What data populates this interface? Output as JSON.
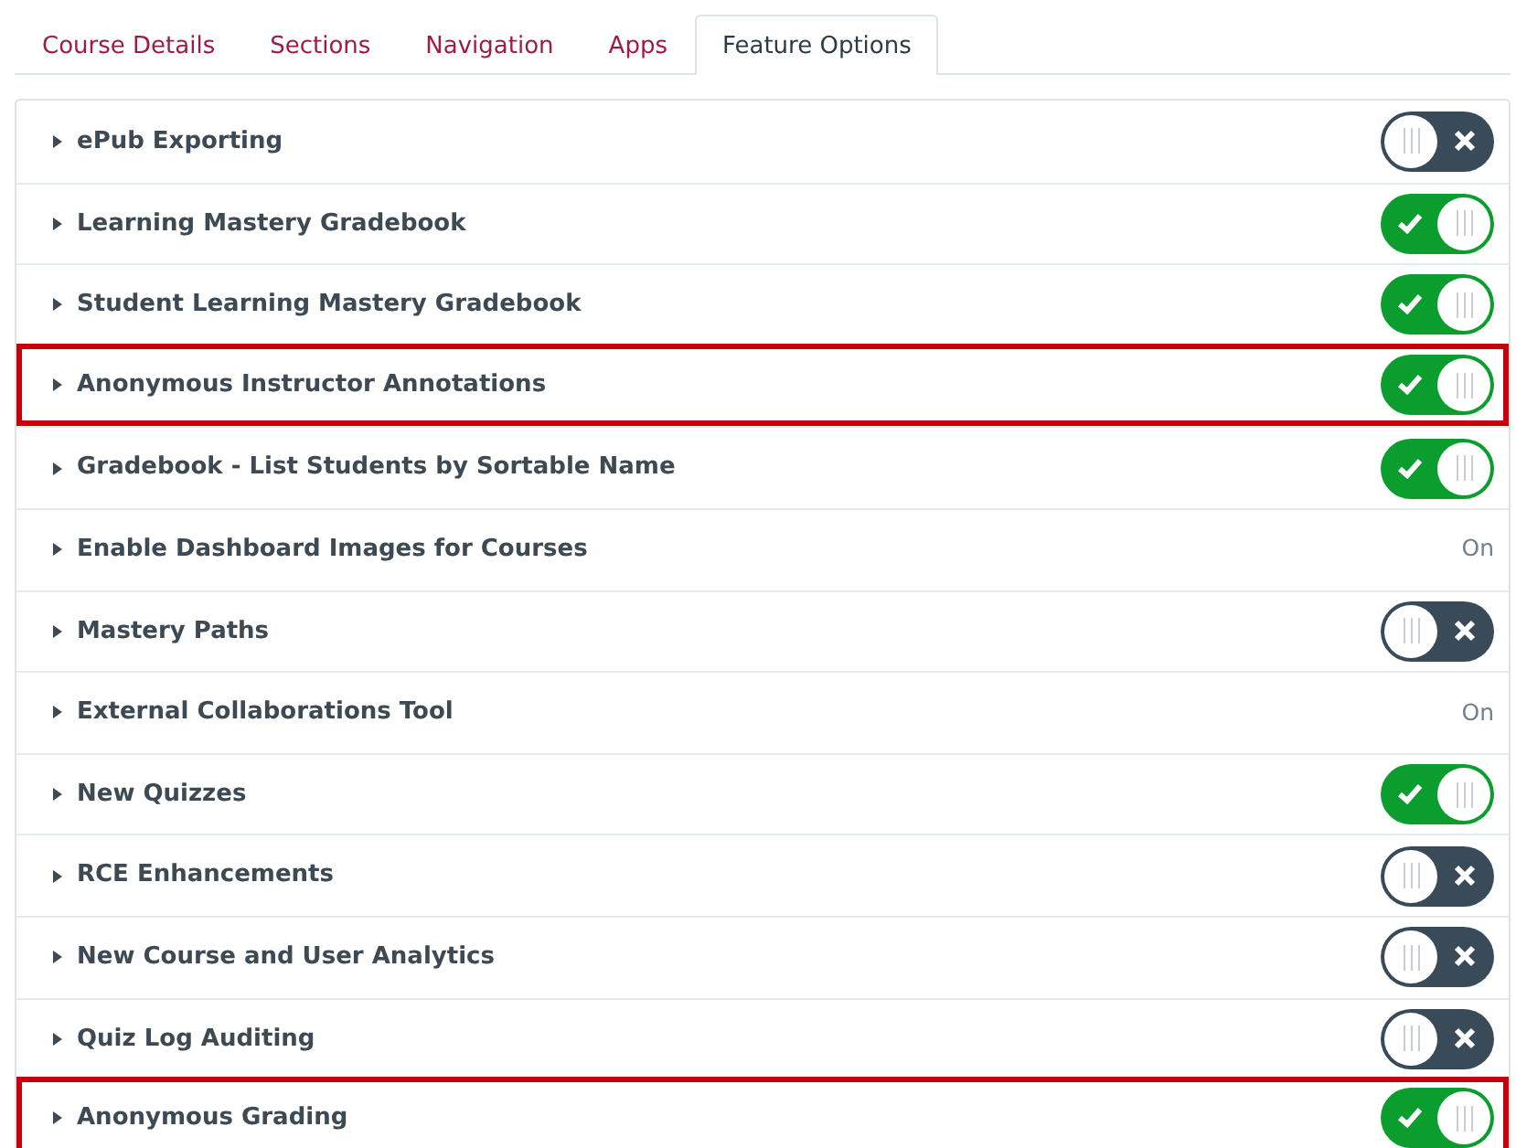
{
  "tabs": [
    {
      "label": "Course Details",
      "selected": false
    },
    {
      "label": "Sections",
      "selected": false
    },
    {
      "label": "Navigation",
      "selected": false
    },
    {
      "label": "Apps",
      "selected": false
    },
    {
      "label": "Feature Options",
      "selected": true
    }
  ],
  "features": [
    {
      "name": "ePub Exporting",
      "kind": "toggle",
      "on": false,
      "highlighted": false
    },
    {
      "name": "Learning Mastery Gradebook",
      "kind": "toggle",
      "on": true,
      "highlighted": false
    },
    {
      "name": "Student Learning Mastery Gradebook",
      "kind": "toggle",
      "on": true,
      "highlighted": false
    },
    {
      "name": "Anonymous Instructor Annotations",
      "kind": "toggle",
      "on": true,
      "highlighted": true
    },
    {
      "name": "Gradebook - List Students by Sortable Name",
      "kind": "toggle",
      "on": true,
      "highlighted": false
    },
    {
      "name": "Enable Dashboard Images for Courses",
      "kind": "status",
      "status": "On",
      "highlighted": false
    },
    {
      "name": "Mastery Paths",
      "kind": "toggle",
      "on": false,
      "highlighted": false
    },
    {
      "name": "External Collaborations Tool",
      "kind": "status",
      "status": "On",
      "highlighted": false
    },
    {
      "name": "New Quizzes",
      "kind": "toggle",
      "on": true,
      "highlighted": false
    },
    {
      "name": "RCE Enhancements",
      "kind": "toggle",
      "on": false,
      "highlighted": false
    },
    {
      "name": "New Course and User Analytics",
      "kind": "toggle",
      "on": false,
      "highlighted": false
    },
    {
      "name": "Quiz Log Auditing",
      "kind": "toggle",
      "on": false,
      "highlighted": false
    },
    {
      "name": "Anonymous Grading",
      "kind": "toggle",
      "on": true,
      "highlighted": true
    }
  ]
}
